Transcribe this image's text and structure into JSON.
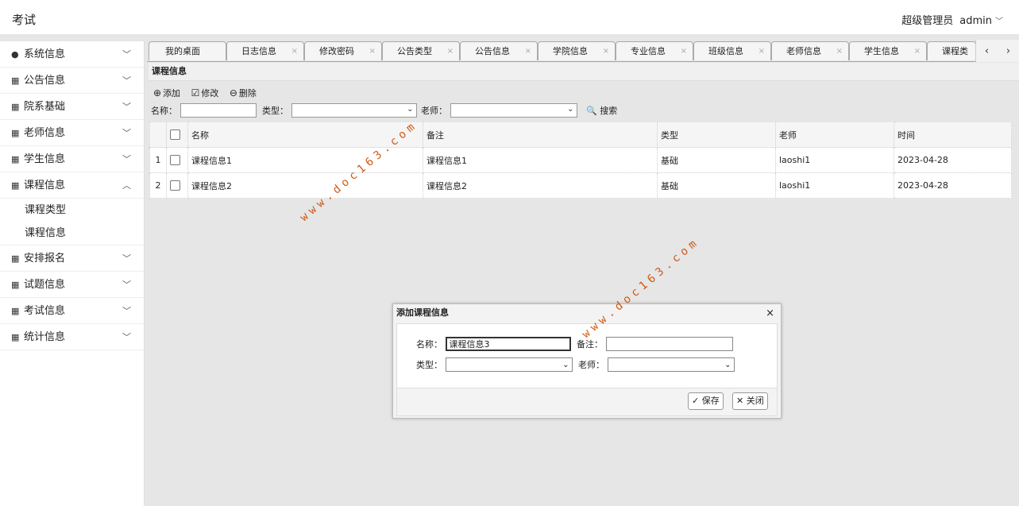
{
  "app": {
    "title": "考试"
  },
  "user": {
    "role": "超级管理员",
    "name": "admin"
  },
  "sidebar": {
    "items": [
      {
        "label": "系统信息",
        "icon": "user-icon"
      },
      {
        "label": "公告信息",
        "icon": "grid-icon"
      },
      {
        "label": "院系基础",
        "icon": "grid-icon"
      },
      {
        "label": "老师信息",
        "icon": "grid-icon"
      },
      {
        "label": "学生信息",
        "icon": "grid-icon"
      },
      {
        "label": "课程信息",
        "icon": "grid-icon",
        "expanded": true
      },
      {
        "label": "安排报名",
        "icon": "grid-icon"
      },
      {
        "label": "试题信息",
        "icon": "grid-icon"
      },
      {
        "label": "考试信息",
        "icon": "grid-icon"
      },
      {
        "label": "统计信息",
        "icon": "grid-icon"
      }
    ],
    "sub_items": [
      "课程类型",
      "课程信息"
    ]
  },
  "tabs": [
    {
      "label": "我的桌面"
    },
    {
      "label": "日志信息"
    },
    {
      "label": "修改密码"
    },
    {
      "label": "公告类型"
    },
    {
      "label": "公告信息"
    },
    {
      "label": "学院信息"
    },
    {
      "label": "专业信息"
    },
    {
      "label": "班级信息"
    },
    {
      "label": "老师信息"
    },
    {
      "label": "学生信息"
    },
    {
      "label": "课程类型"
    }
  ],
  "panel": {
    "title": "课程信息",
    "toolbar": {
      "add": "添加",
      "edit": "修改",
      "delete": "删除"
    },
    "search": {
      "name_label": "名称：",
      "type_label": "类型：",
      "teacher_label": "老师：",
      "button": "搜索"
    },
    "columns": [
      "名称",
      "备注",
      "类型",
      "老师",
      "时间"
    ],
    "rows": [
      {
        "num": "1",
        "name": "课程信息1",
        "note": "课程信息1",
        "type": "基础",
        "teacher": "laoshi1",
        "time": "2023-04-28"
      },
      {
        "num": "2",
        "name": "课程信息2",
        "note": "课程信息2",
        "type": "基础",
        "teacher": "laoshi1",
        "time": "2023-04-28"
      }
    ]
  },
  "dialog": {
    "title": "添加课程信息",
    "name_label": "名称：",
    "name_value": "课程信息3",
    "note_label": "备注：",
    "note_value": "",
    "type_label": "类型：",
    "teacher_label": "老师：",
    "save": "保存",
    "close": "关闭"
  },
  "watermark": "www.doc163.com",
  "colors": {
    "watermark": "#cc4a00",
    "accent": "#3a6ea5"
  }
}
